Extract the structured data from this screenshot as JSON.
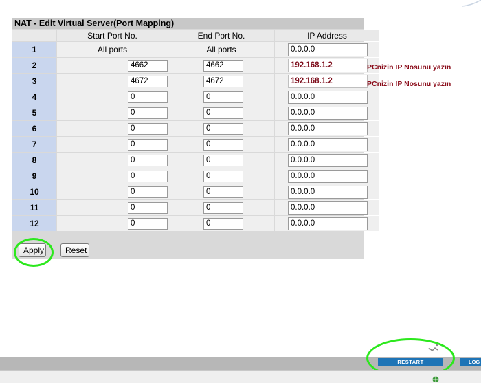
{
  "title": "NAT - Edit Virtual Server(Port Mapping)",
  "headers": [
    "Start Port No.",
    "End Port No.",
    "IP Address"
  ],
  "rows": [
    {
      "num": "1",
      "start": "All ports",
      "end": "All ports",
      "ip": "0.0.0.0"
    },
    {
      "num": "2",
      "start": "4662",
      "end": "4662",
      "ip": "192.168.1.2"
    },
    {
      "num": "3",
      "start": "4672",
      "end": "4672",
      "ip": "192.168.1.2"
    },
    {
      "num": "4",
      "start": "0",
      "end": "0",
      "ip": "0.0.0.0"
    },
    {
      "num": "5",
      "start": "0",
      "end": "0",
      "ip": "0.0.0.0"
    },
    {
      "num": "6",
      "start": "0",
      "end": "0",
      "ip": "0.0.0.0"
    },
    {
      "num": "7",
      "start": "0",
      "end": "0",
      "ip": "0.0.0.0"
    },
    {
      "num": "8",
      "start": "0",
      "end": "0",
      "ip": "0.0.0.0"
    },
    {
      "num": "9",
      "start": "0",
      "end": "0",
      "ip": "0.0.0.0"
    },
    {
      "num": "10",
      "start": "0",
      "end": "0",
      "ip": "0.0.0.0"
    },
    {
      "num": "11",
      "start": "0",
      "end": "0",
      "ip": "0.0.0.0"
    },
    {
      "num": "12",
      "start": "0",
      "end": "0",
      "ip": "0.0.0.0"
    }
  ],
  "notes": {
    "row2": "PCnizin IP Nosunu yazın",
    "row3": "PCnizin IP Nosunu yazın"
  },
  "buttons": {
    "apply": "Apply",
    "reset": "Reset",
    "restart": "RESTART",
    "logout": "LOG"
  },
  "colors": {
    "row_number_bg": "#c9d6ee",
    "annotation_red": "#8a0b19",
    "highlight_circle": "#2ce81d",
    "restart_bar": "#1e74b6"
  }
}
